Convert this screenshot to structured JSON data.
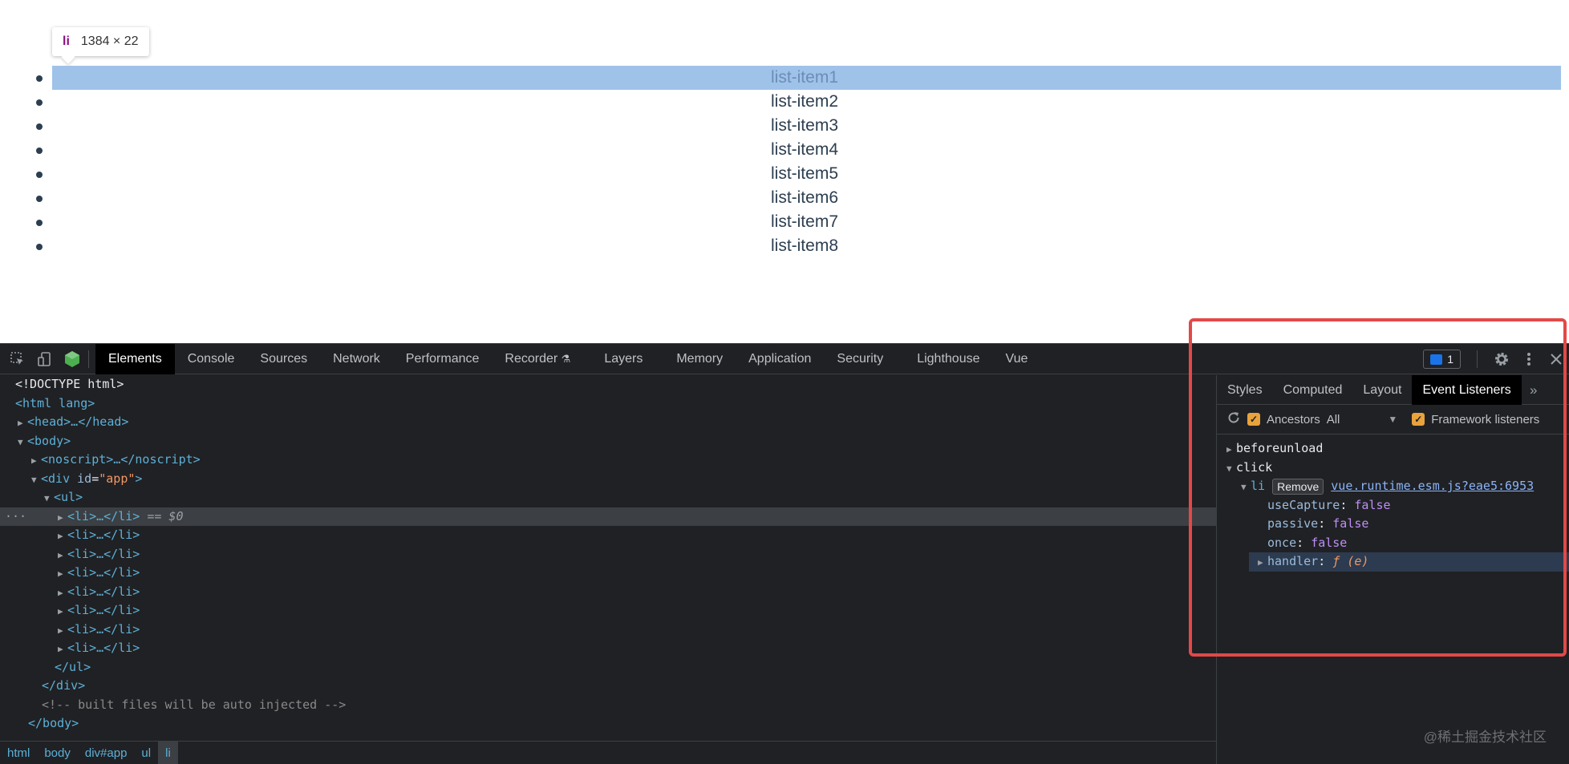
{
  "page": {
    "tooltip": {
      "tag": "li",
      "size": "1384 × 22"
    },
    "list_items": [
      "list-item1",
      "list-item2",
      "list-item3",
      "list-item4",
      "list-item5",
      "list-item6",
      "list-item7",
      "list-item8"
    ]
  },
  "devtools": {
    "toolbar": {
      "icons": [
        "inspect-element-icon",
        "device-toolbar-icon",
        "vue-node-icon"
      ],
      "tabs": [
        "Elements",
        "Console",
        "Sources",
        "Network",
        "Performance",
        "Recorder",
        "Layers",
        "Memory",
        "Application",
        "Security",
        "Lighthouse",
        "Vue"
      ],
      "active_tab": "Elements",
      "issues_count": "1"
    },
    "tree": {
      "doctype": "<!DOCTYPE html>",
      "html_open": "<html lang>",
      "head": "<head>…</head>",
      "body_open": "<body>",
      "noscript": "<noscript>…</noscript>",
      "div_open_tag": "<div ",
      "div_attr_name": "id",
      "div_attr_value": "\"app\"",
      "div_close_bracket": ">",
      "ul_open": "<ul>",
      "li_collapsed": "<li>…</li>",
      "selected_marker": "== $0",
      "ul_close": "</ul>",
      "div_close": "</div>",
      "comment": "<!-- built files will be auto injected -->",
      "body_close": "</body>"
    },
    "breadcrumbs": [
      "html",
      "body",
      "div#app",
      "ul",
      "li"
    ],
    "side_panel": {
      "tabs": [
        "Styles",
        "Computed",
        "Layout",
        "Event Listeners"
      ],
      "active_tab": "Event Listeners",
      "ancestors_label": "Ancestors",
      "filter_value": "All",
      "framework_label": "Framework listeners",
      "events": {
        "beforeunload": "beforeunload",
        "click": "click",
        "listener_node": "li",
        "remove_label": "Remove",
        "source_link": "vue.runtime.esm.js?eae5:6953",
        "props": [
          {
            "key": "useCapture",
            "value": "false"
          },
          {
            "key": "passive",
            "value": "false"
          },
          {
            "key": "once",
            "value": "false"
          }
        ],
        "handler_key": "handler",
        "handler_value": "ƒ (e)"
      }
    },
    "watermark": "@稀土掘金技术社区"
  },
  "colors": {
    "highlight": "#9fc2e9",
    "devtools_bg": "#202124",
    "annotation_red": "#e34848",
    "tag_blue": "#5db0d7"
  }
}
